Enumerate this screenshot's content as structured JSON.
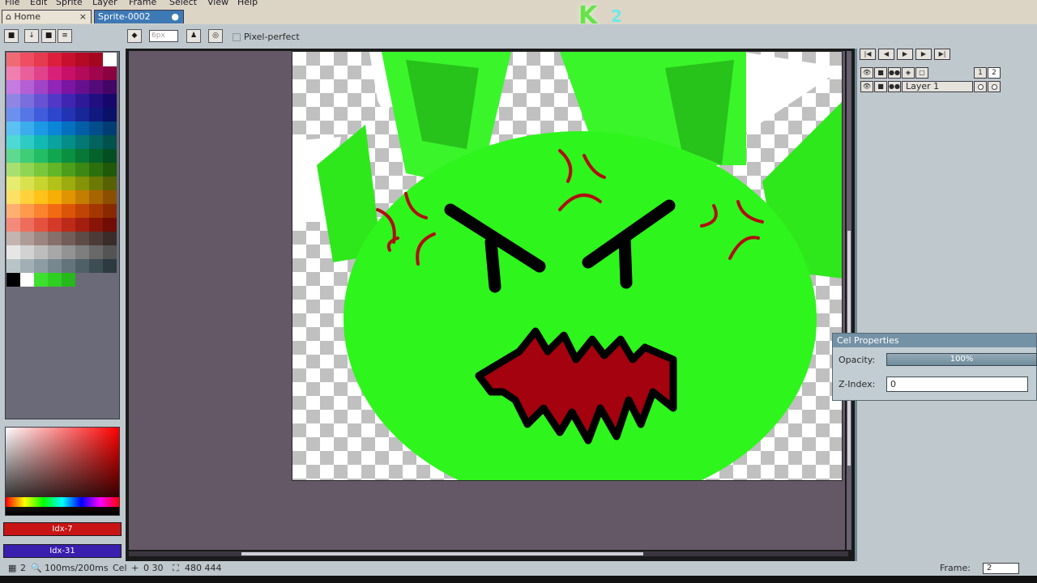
{
  "menubar": {
    "items": [
      "File",
      "Edit",
      "Sprite",
      "Layer",
      "Frame",
      "Select",
      "View",
      "Help"
    ]
  },
  "tabs": [
    {
      "label": "Home",
      "close": "×"
    },
    {
      "label": "Sprite-0002",
      "close": "●"
    }
  ],
  "app_logo": {
    "letter": "K",
    "number": "2"
  },
  "toolbar": {
    "brush_size_value": "6px",
    "pixel_perfect_label": "Pixel-perfect"
  },
  "palette": {
    "colors": [
      "#f06a74",
      "#ef4d62",
      "#e63a4e",
      "#dc1f3c",
      "#c8102e",
      "#b40a26",
      "#a5061f",
      "#ffffff",
      "#f07fb0",
      "#e95f9c",
      "#e0438c",
      "#d8207a",
      "#c81068",
      "#b40a5a",
      "#a0064d",
      "#8a0340",
      "#c57be0",
      "#b55fd4",
      "#a143c6",
      "#9025b8",
      "#7b15a2",
      "#67108e",
      "#550a7a",
      "#430566",
      "#8f86e3",
      "#7b6edc",
      "#6752d2",
      "#5238c6",
      "#3f25b0",
      "#2e1999",
      "#210f82",
      "#16086b",
      "#6c90ee",
      "#5576e4",
      "#3f5cda",
      "#2e46cc",
      "#2234b3",
      "#182698",
      "#101a7e",
      "#0a1166",
      "#5bc1f2",
      "#3bacec",
      "#1d98e4",
      "#0b85d8",
      "#0670c0",
      "#035ea6",
      "#024d8c",
      "#013d73",
      "#4fd9d4",
      "#2ecbc5",
      "#14b8b3",
      "#0aa39f",
      "#068d89",
      "#047874",
      "#03645f",
      "#02514d",
      "#5fd98f",
      "#3fcd78",
      "#22bd64",
      "#12a650",
      "#0b8f41",
      "#077835",
      "#05622b",
      "#034e22",
      "#a8e070",
      "#91d555",
      "#79c83c",
      "#63b628",
      "#4d9f1b",
      "#3b8813",
      "#2c700d",
      "#1f5909",
      "#e6ec70",
      "#d9e24e",
      "#c8d42f",
      "#b4c118",
      "#9cab0d",
      "#849308",
      "#6c7a05",
      "#566203",
      "#ffe066",
      "#ffd23d",
      "#ffc21a",
      "#f7ae05",
      "#e09402",
      "#c47c01",
      "#a76500",
      "#8a5000",
      "#ffb070",
      "#ff9a4d",
      "#fb832d",
      "#f26b12",
      "#db5508",
      "#c04404",
      "#a43602",
      "#882a01",
      "#f48a7a",
      "#ed6d5c",
      "#e2523f",
      "#d43a27",
      "#bd2a18",
      "#a31e0f",
      "#891408",
      "#700d04",
      "#c4b4b0",
      "#b09c97",
      "#9b8580",
      "#87706b",
      "#735d58",
      "#5f4b46",
      "#4c3b37",
      "#3a2c29",
      "#e6e6e6",
      "#d2d2d2",
      "#bdbdbd",
      "#a8a8a8",
      "#939393",
      "#7e7e7e",
      "#696969",
      "#545454",
      "#b8c4c8",
      "#a2b0b5",
      "#8c9ca2",
      "#77888f",
      "#63747b",
      "#506067",
      "#3e4d53",
      "#2d3a40",
      "#000000",
      "#ffffff",
      "#3de02e",
      "#2fcf22",
      "#27b81c",
      "#6a6a78",
      "#6a6a78",
      "#6a6a78"
    ],
    "fg_label": "Idx-7",
    "bg_label": "Idx-31",
    "fg_color": "#c81414",
    "bg_color": "#3a1fae"
  },
  "timeline": {
    "nav_buttons": [
      "first-frame",
      "previous-frame",
      "play",
      "next-frame",
      "last-frame"
    ],
    "frame_numbers": [
      "1",
      "2"
    ],
    "layer_name": "Layer 1"
  },
  "cel_properties": {
    "title": "Cel Properties",
    "opacity_label": "Opacity:",
    "opacity_value": "100%",
    "zindex_label": "Z-Index:",
    "zindex_value": "0"
  },
  "statusbar": {
    "frame_count": "2",
    "duration": "100ms/200ms",
    "cel_label": "Cel",
    "position": "0 30",
    "size": "480 444",
    "frame_label": "Frame:",
    "frame_value": "2"
  },
  "colors": {
    "canvas_bg": "#645866",
    "panel_bg": "#bfc8cd",
    "accent": "#3d79b5",
    "monster_green": "#2ef51c"
  }
}
